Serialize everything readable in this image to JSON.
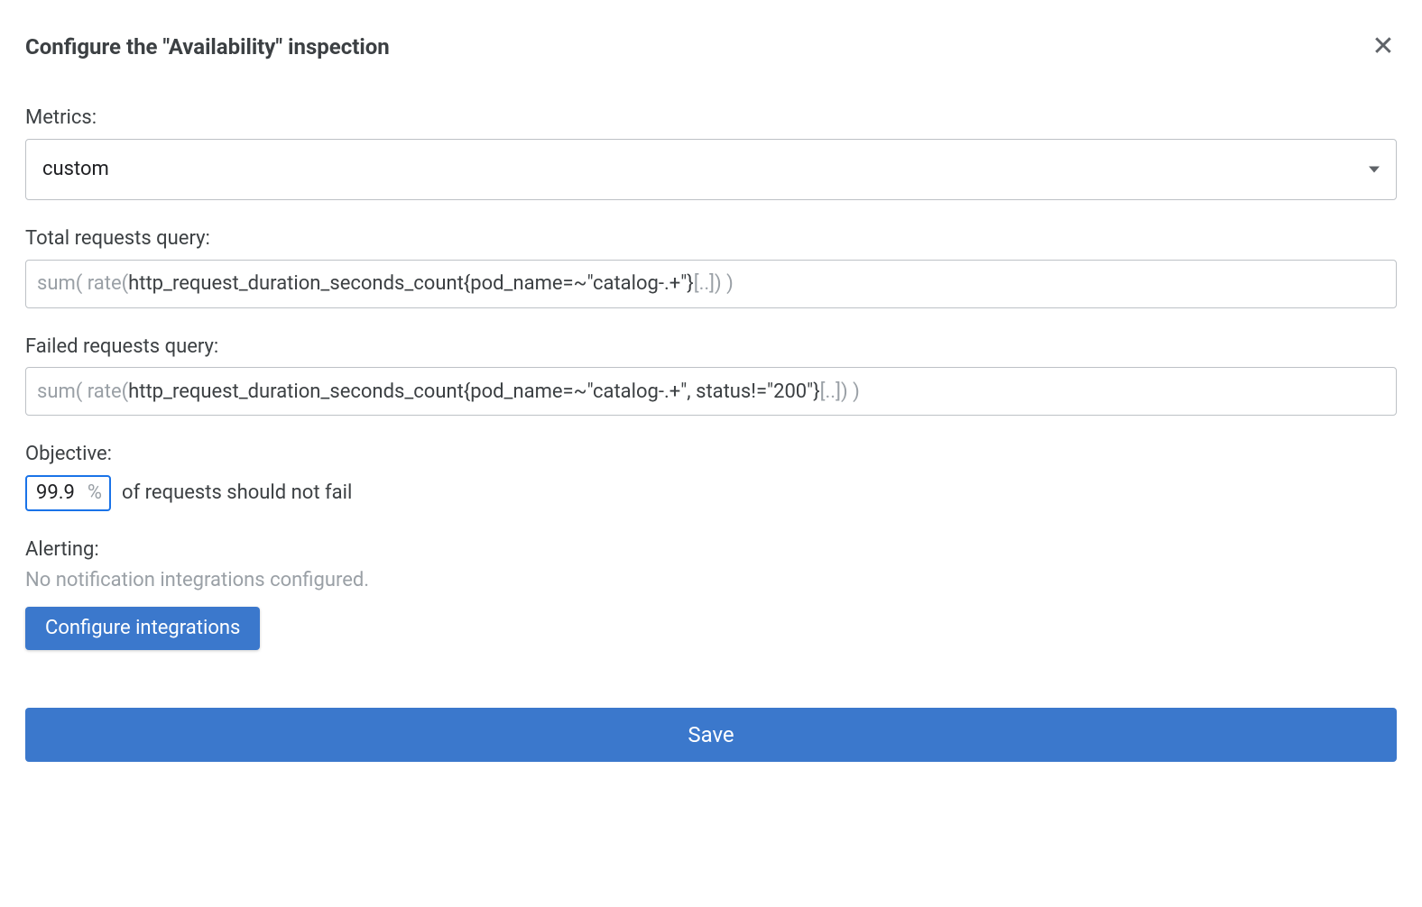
{
  "header": {
    "title": "Configure the \"Availability\" inspection"
  },
  "metrics": {
    "label": "Metrics:",
    "value": "custom"
  },
  "total_query": {
    "label": "Total requests query:",
    "value_prefix_dim": "sum( rate( ",
    "value_body": "http_request_duration_seconds_count{pod_name=~\"catalog-.+\"}",
    "value_gap_dim": " [..]",
    "value_suffix_dim": ") )"
  },
  "failed_query": {
    "label": "Failed requests query:",
    "value_prefix_dim": "sum( rate( ",
    "value_body": "http_request_duration_seconds_count{pod_name=~\"catalog-.+\", status!=\"200\"}",
    "value_gap_dim": " [..]",
    "value_suffix_dim": ") )"
  },
  "objective": {
    "label": "Objective:",
    "value": "99.9",
    "unit": "%",
    "suffix_text": "of requests should not fail"
  },
  "alerting": {
    "label": "Alerting:",
    "status": "No notification integrations configured.",
    "configure_button": "Configure integrations"
  },
  "save_button": "Save"
}
